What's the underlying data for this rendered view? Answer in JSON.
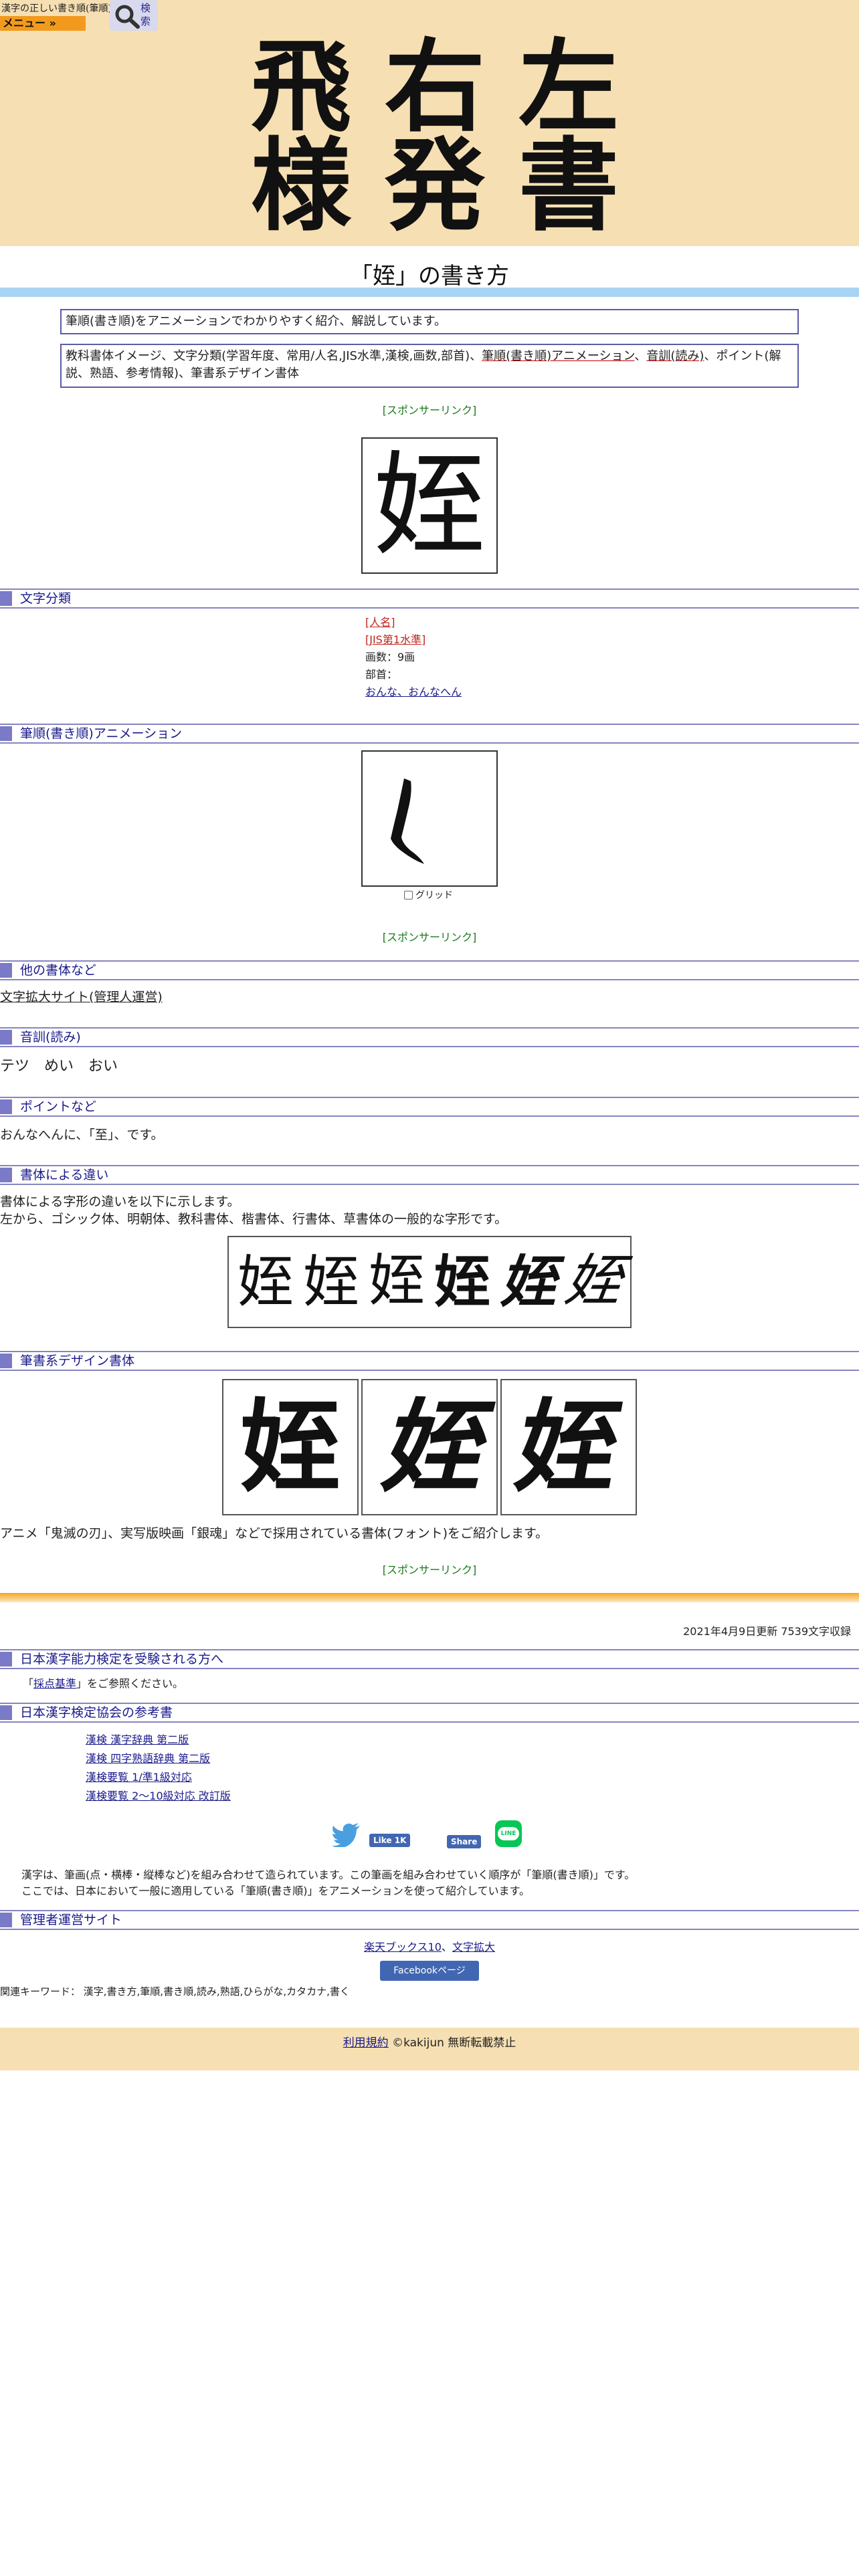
{
  "header": {
    "logo_text": "漢字の正しい書き順(筆順)",
    "menu_label": "メニュー »",
    "search_label": "検索"
  },
  "hero": {
    "kanji": [
      "飛",
      "右",
      "左",
      "様",
      "発",
      "書"
    ]
  },
  "page": {
    "title": "「姪」の書き方",
    "intro": "筆順(書き順)をアニメーションでわかりやすく紹介、解説しています。",
    "contents_1": "教科書体イメージ、文字分類(学習年度、常用/人名,JIS水準,漢検,画数,部首)、",
    "contents_link_1": "筆順(書き順)アニメーション",
    "contents_sep": "、",
    "contents_link_2": "音訓(読み)",
    "contents_2": "、ポイント(解説、熟語、参考情報)、筆書系デザイン書体",
    "main_kanji": "姪",
    "sponsor": "[スポンサーリンク]"
  },
  "classification": {
    "heading": "文字分類",
    "jinmei": "[人名]",
    "jis": "[JIS第1水準]",
    "strokes": "画数：9画",
    "radical_label": "部首：",
    "radical_link": "おんな、おんなへん"
  },
  "animation": {
    "heading": "筆順(書き順)アニメーション",
    "grid_label": "グリッド"
  },
  "other_fonts": {
    "heading": "他の書体など",
    "link": "文字拡大サイト(管理人運営)"
  },
  "reading": {
    "heading": "音訓(読み)",
    "text": "テツ　めい　おい"
  },
  "point": {
    "heading": "ポイントなど",
    "text": "おんなへんに、「至」、です。"
  },
  "font_diff": {
    "heading": "書体による違い",
    "line1": "書体による字形の違いを以下に示します。",
    "line2": "左から、ゴシック体、明朝体、教科書体、楷書体、行書体、草書体の一般的な字形です。",
    "glyph": "姪"
  },
  "design": {
    "heading": "筆書系デザイン書体",
    "glyph": "姪",
    "caption": "アニメ「鬼滅の刃」、実写版映画「銀魂」などで採用されている書体(フォント)をご紹介します。"
  },
  "update": "2021年4月9日更新 7539文字収録",
  "kanken": {
    "heading": "日本漢字能力検定を受験される方へ",
    "text_pre": "「",
    "text_link": "採点基準",
    "text_post": "」をご参照ください。"
  },
  "refs": {
    "heading": "日本漢字検定協会の参考書",
    "items": [
      "漢検 漢字辞典 第二版",
      "漢検 四字熟語辞典 第二版",
      "漢検要覧 1/準1級対応",
      "漢検要覧 2～10級対応 改訂版"
    ]
  },
  "social": {
    "like": "Like 1K",
    "share": "Share",
    "line": "LINE"
  },
  "about": {
    "line1": "漢字は、筆画(点・横棒・縦棒など)を組み合わせて造られています。この筆画を組み合わせていく順序が「筆順(書き順)」です。",
    "line2": "ここでは、日本において一般に適用している「筆順(書き順)」をアニメーションを使って紹介しています。"
  },
  "admin": {
    "heading": "管理者運営サイト",
    "link1": "楽天ブックス10",
    "sep": "、",
    "link2": "文字拡大",
    "fb_page": "Facebookページ",
    "keywords": "関連キーワード： 漢字,書き方,筆順,書き順,読み,熟語,ひらがな,カタカナ,書く"
  },
  "footer": {
    "terms": "利用規約",
    "copyright": "©kakijun 無断転載禁止"
  },
  "colors": {
    "hero_bg": "#f6dfb2",
    "menu_orange": "#f29a1e",
    "section_line": "#8585c0",
    "link": "#1a1a8c",
    "sponsor_green": "#1a7a1a",
    "red_label": "#c0241c"
  }
}
